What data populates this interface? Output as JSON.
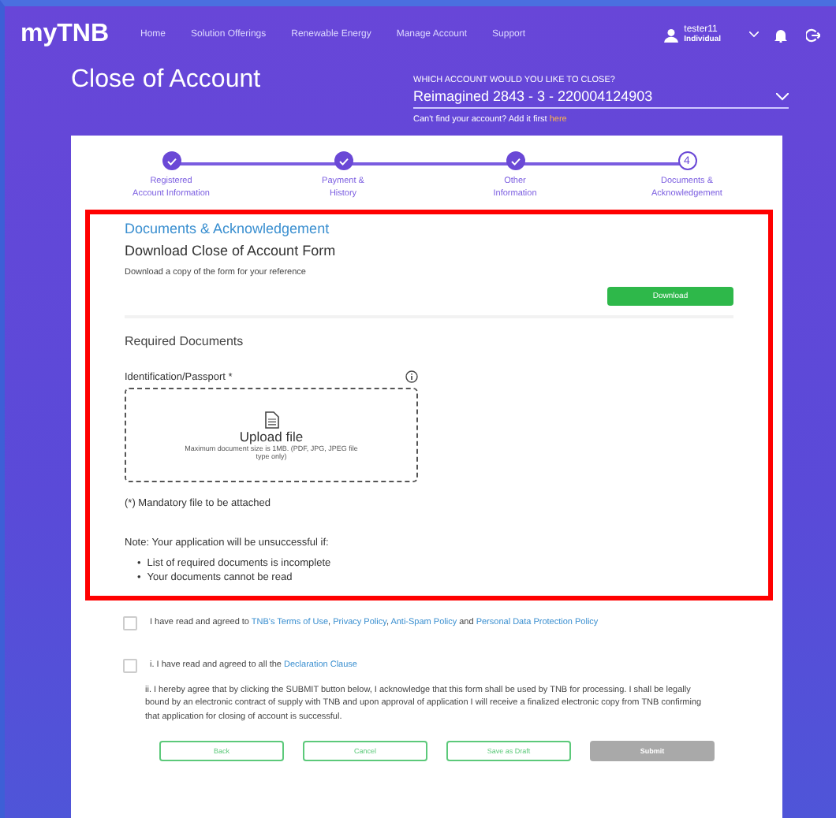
{
  "nav": {
    "logo": "myTNB",
    "links": [
      "Home",
      "Solution Offerings",
      "Renewable Energy",
      "Manage Account",
      "Support"
    ],
    "user": {
      "name": "tester11",
      "role": "Individual"
    }
  },
  "header": {
    "title": "Close of Account",
    "account_label": "WHICH ACCOUNT WOULD YOU LIKE TO CLOSE?",
    "account_value": "Reimagined 2843 - 3 - 220004124903",
    "hint": "Can't find your account? Add it first ",
    "hint_link": "here"
  },
  "steps": [
    {
      "label": "Registered\nAccount Information",
      "done": true
    },
    {
      "label": "Payment &\nHistory",
      "done": true
    },
    {
      "label": "Other\nInformation",
      "done": true
    },
    {
      "label": "Documents &\nAcknowledgement",
      "done": false,
      "number": "4"
    }
  ],
  "section": {
    "title": "Documents & Acknowledgement",
    "form_title": "Download Close of Account Form",
    "form_desc": "Download a copy of the form for your reference",
    "download": "Download"
  },
  "required": {
    "title": "Required Documents",
    "field_label": "Identification/Passport *",
    "upload_title": "Upload file",
    "upload_hint": "Maximum document size is 1MB. (PDF, JPG, JPEG file type only)",
    "mandatory": "(*) Mandatory file to be attached",
    "note": "Note: Your application will be unsuccessful if:",
    "bullets": [
      {
        "marker": "•",
        "text": "List of required documents is incomplete"
      },
      {
        "marker": "•",
        "text": "Your documents cannot be read"
      }
    ]
  },
  "agreements": [
    {
      "checked": false,
      "parts": [
        {
          "kind": "text",
          "text": "I have read and agreed to "
        },
        {
          "kind": "link",
          "text": "TNB's Terms of Use"
        },
        {
          "kind": "text",
          "text": ", "
        },
        {
          "kind": "link",
          "text": "Privacy Policy"
        },
        {
          "kind": "text",
          "text": ", "
        },
        {
          "kind": "link",
          "text": "Anti-Spam Policy"
        },
        {
          "kind": "text",
          "text": " and "
        },
        {
          "kind": "link",
          "text": "Personal Data Protection Policy"
        }
      ]
    },
    {
      "checked": false,
      "parts": [
        {
          "kind": "text",
          "text": "i. I have read and agreed to all the "
        },
        {
          "kind": "link",
          "text": "Declaration Clause"
        }
      ]
    }
  ],
  "declaration": "ii. I hereby agree that by clicking the SUBMIT button below, I acknowledge that this form shall be used by TNB for processing. I shall be legally bound by an electronic contract of supply with TNB and upon approval of application I will receive a finalized electronic copy from TNB confirming that application for closing of account is successful.",
  "buttons": [
    {
      "label": "Back",
      "disabled": false
    },
    {
      "label": "Cancel",
      "disabled": false
    },
    {
      "label": "Save as Draft",
      "disabled": false
    },
    {
      "label": "Submit",
      "disabled": true
    }
  ]
}
